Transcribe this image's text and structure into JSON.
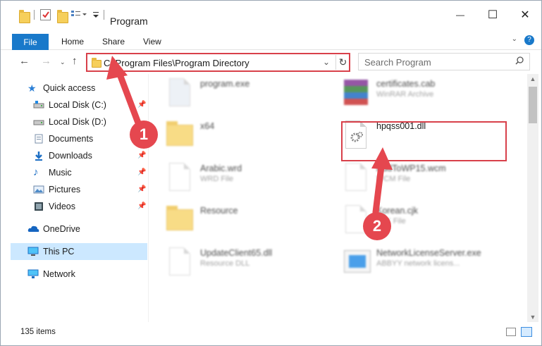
{
  "window": {
    "title": "Program",
    "controls": {
      "minimize": "—",
      "maximize": "☐",
      "close": "✕"
    }
  },
  "ribbon": {
    "tabs": [
      "File",
      "Home",
      "Share",
      "View"
    ]
  },
  "address_bar": {
    "path": "C:\\Program Files\\Program Directory",
    "search_placeholder": "Search Program"
  },
  "sidebar": {
    "quick_access": "Quick access",
    "items": [
      {
        "label": "Local Disk (C:)",
        "icon": "drive-icon",
        "pinned": true
      },
      {
        "label": "Local Disk (D:)",
        "icon": "drive-icon",
        "pinned": false
      },
      {
        "label": "Documents",
        "icon": "documents-icon",
        "pinned": true
      },
      {
        "label": "Downloads",
        "icon": "downloads-icon",
        "pinned": true
      },
      {
        "label": "Music",
        "icon": "music-icon",
        "pinned": true
      },
      {
        "label": "Pictures",
        "icon": "pictures-icon",
        "pinned": true
      },
      {
        "label": "Videos",
        "icon": "videos-icon",
        "pinned": true
      }
    ],
    "onedrive": "OneDrive",
    "this_pc": "This PC",
    "network": "Network"
  },
  "files": [
    {
      "name": "program.exe",
      "type": "",
      "icon": "exe-icon"
    },
    {
      "name": "certificates.cab",
      "type": "WinRAR Archive",
      "icon": "archive-icon"
    },
    {
      "name": "x64",
      "type": "",
      "icon": "folder-icon"
    },
    {
      "name": "hpqss001.dll",
      "type": "",
      "icon": "dll-icon"
    },
    {
      "name": "Arabic.wrd",
      "type": "WRD File",
      "icon": "file-icon"
    },
    {
      "name": "AddToWP15.wcm",
      "type": "WCM File",
      "icon": "file-icon"
    },
    {
      "name": "Resource",
      "type": "",
      "icon": "folder-icon"
    },
    {
      "name": "Korean.cjk",
      "type": "CJK File",
      "icon": "file-icon"
    },
    {
      "name": "UpdateClient65.dll",
      "type": "Resource DLL",
      "icon": "dll-icon"
    },
    {
      "name": "NetworkLicenseServer.exe",
      "type": "ABBYY network licens...",
      "icon": "exe-icon"
    }
  ],
  "status": {
    "item_count": "135 items"
  },
  "callouts": {
    "first": "1",
    "second": "2"
  },
  "colors": {
    "accent": "#1979ca",
    "highlight_red": "#d8404a",
    "badge_red": "#e5474f",
    "selection": "#cce8ff"
  }
}
